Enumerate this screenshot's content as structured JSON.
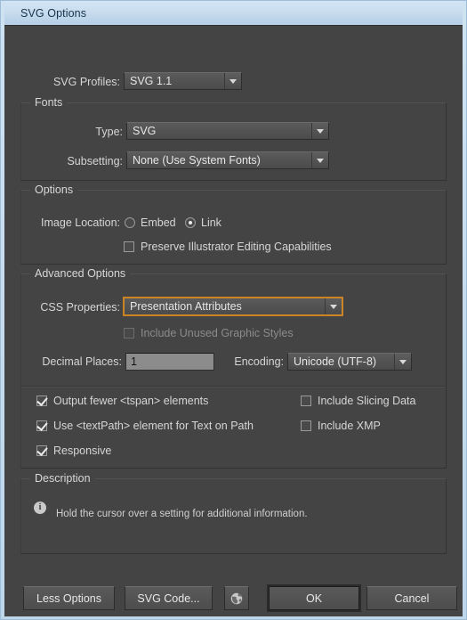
{
  "window": {
    "title": "SVG Options"
  },
  "top": {
    "svg_profiles_label": "SVG Profiles:",
    "svg_profiles_value": "SVG 1.1"
  },
  "fonts": {
    "legend": "Fonts",
    "type_label": "Type:",
    "type_value": "SVG",
    "subsetting_label": "Subsetting:",
    "subsetting_value": "None (Use System Fonts)"
  },
  "options": {
    "legend": "Options",
    "image_location_label": "Image Location:",
    "embed_label": "Embed",
    "embed_selected": false,
    "link_label": "Link",
    "link_selected": true,
    "preserve_label": "Preserve Illustrator Editing Capabilities",
    "preserve_checked": false
  },
  "advanced": {
    "legend": "Advanced Options",
    "css_properties_label": "CSS Properties:",
    "css_properties_value": "Presentation Attributes",
    "css_properties_focus_color": "#d08a2e",
    "include_unused_label": "Include Unused Graphic Styles",
    "include_unused_checked": false,
    "include_unused_disabled": true,
    "decimal_places_label": "Decimal Places:",
    "decimal_places_value": "1",
    "encoding_label": "Encoding:",
    "encoding_value": "Unicode (UTF-8)"
  },
  "checkboxes": {
    "output_fewer_tspan": {
      "label": "Output fewer <tspan> elements",
      "checked": true
    },
    "use_textpath": {
      "label": "Use <textPath> element for Text on Path",
      "checked": true
    },
    "responsive": {
      "label": "Responsive",
      "checked": true
    },
    "include_slicing_data": {
      "label": "Include Slicing Data",
      "checked": false
    },
    "include_xmp": {
      "label": "Include XMP",
      "checked": false
    }
  },
  "description": {
    "legend": "Description",
    "info_icon": "info-icon",
    "info_glyph": "i",
    "text": "Hold the cursor over a setting for additional information."
  },
  "footer": {
    "less_options": "Less Options",
    "svg_code": "SVG Code...",
    "globe_icon": "globe-icon",
    "ok": "OK",
    "cancel": "Cancel"
  }
}
